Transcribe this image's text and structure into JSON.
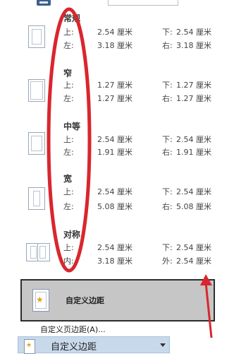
{
  "presets": [
    {
      "name": "常规",
      "label1": "上:",
      "value1": "2.54 厘米",
      "label2": "下:",
      "value2": "2.54 厘米",
      "label3": "左:",
      "value3": "3.18 厘米",
      "label4": "右:",
      "value4": "3.18 厘米"
    },
    {
      "name": "窄",
      "label1": "上:",
      "value1": "1.27 厘米",
      "label2": "下:",
      "value2": "1.27 厘米",
      "label3": "左:",
      "value3": "1.27 厘米",
      "label4": "右:",
      "value4": "1.27 厘米"
    },
    {
      "name": "中等",
      "label1": "上:",
      "value1": "2.54 厘米",
      "label2": "下:",
      "value2": "2.54 厘米",
      "label3": "左:",
      "value3": "1.91 厘米",
      "label4": "右:",
      "value4": "1.91 厘米"
    },
    {
      "name": "宽",
      "label1": "上:",
      "value1": "2.54 厘米",
      "label2": "下:",
      "value2": "2.54 厘米",
      "label3": "左:",
      "value3": "5.08 厘米",
      "label4": "右:",
      "value4": "5.08 厘米"
    },
    {
      "name": "对称",
      "label1": "上:",
      "value1": "2.54 厘米",
      "label2": "下:",
      "value2": "2.54 厘米",
      "label3": "内:",
      "value3": "3.18 厘米",
      "label4": "外:",
      "value4": "2.54 厘米"
    }
  ],
  "custom_margin": {
    "label": "自定义边距"
  },
  "custom_page_margin_link": {
    "label": "自定义页边距(A)..."
  },
  "bottom_bar": {
    "label": "自定义边距"
  },
  "colors": {
    "annotation": "#d9262e",
    "selection_bg": "#c6c6c6",
    "bar_bg": "#c9d9ec"
  },
  "icons": [
    "page-margin-icon",
    "book-margin-icon",
    "star-icon",
    "dropdown-caret-icon"
  ]
}
